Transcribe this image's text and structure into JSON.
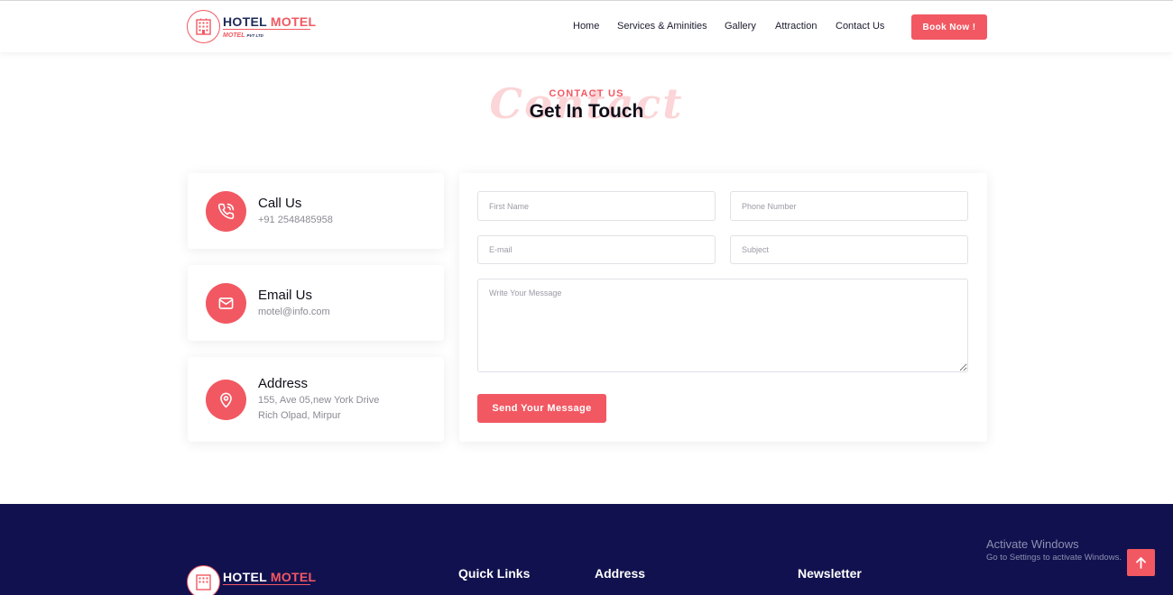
{
  "brand": {
    "word1": "HOTEL",
    "word2": "MOTEL",
    "sub": "MOTEL",
    "sub_small": "PVT LTD"
  },
  "nav": {
    "items": [
      {
        "label": "Home"
      },
      {
        "label": "Services & Aminities"
      },
      {
        "label": "Gallery"
      },
      {
        "label": "Attraction"
      },
      {
        "label": "Contact Us"
      }
    ],
    "book_label": "Book Now !"
  },
  "section": {
    "ghost": "Contact",
    "kicker": "CONTACT US",
    "title": "Get In Touch"
  },
  "contact_cards": [
    {
      "icon": "phone-icon",
      "title": "Call Us",
      "lines": [
        "+91 2548485958"
      ]
    },
    {
      "icon": "mail-icon",
      "title": "Email Us",
      "lines": [
        "motel@info.com"
      ]
    },
    {
      "icon": "location-pin-icon",
      "title": "Address",
      "lines": [
        "155, Ave 05,new York Drive",
        "Rich Olpad, Mirpur"
      ]
    }
  ],
  "form": {
    "first_name": {
      "placeholder": "First Name",
      "value": ""
    },
    "phone": {
      "placeholder": "Phone Number",
      "value": ""
    },
    "email": {
      "placeholder": "E-mail",
      "value": ""
    },
    "subject": {
      "placeholder": "Subject",
      "value": ""
    },
    "message": {
      "placeholder": "Write Your Message",
      "value": ""
    },
    "send_label": "Send Your Message"
  },
  "footer": {
    "headings": [
      "Quick Links",
      "Address",
      "Newsletter"
    ]
  },
  "watermark": {
    "line1": "Activate Windows",
    "line2": "Go to Settings to activate Windows."
  },
  "colors": {
    "accent": "#f25862",
    "navy": "#1e2a5a",
    "footer_bg": "#11114f",
    "ghost": "#fbd5d7"
  }
}
